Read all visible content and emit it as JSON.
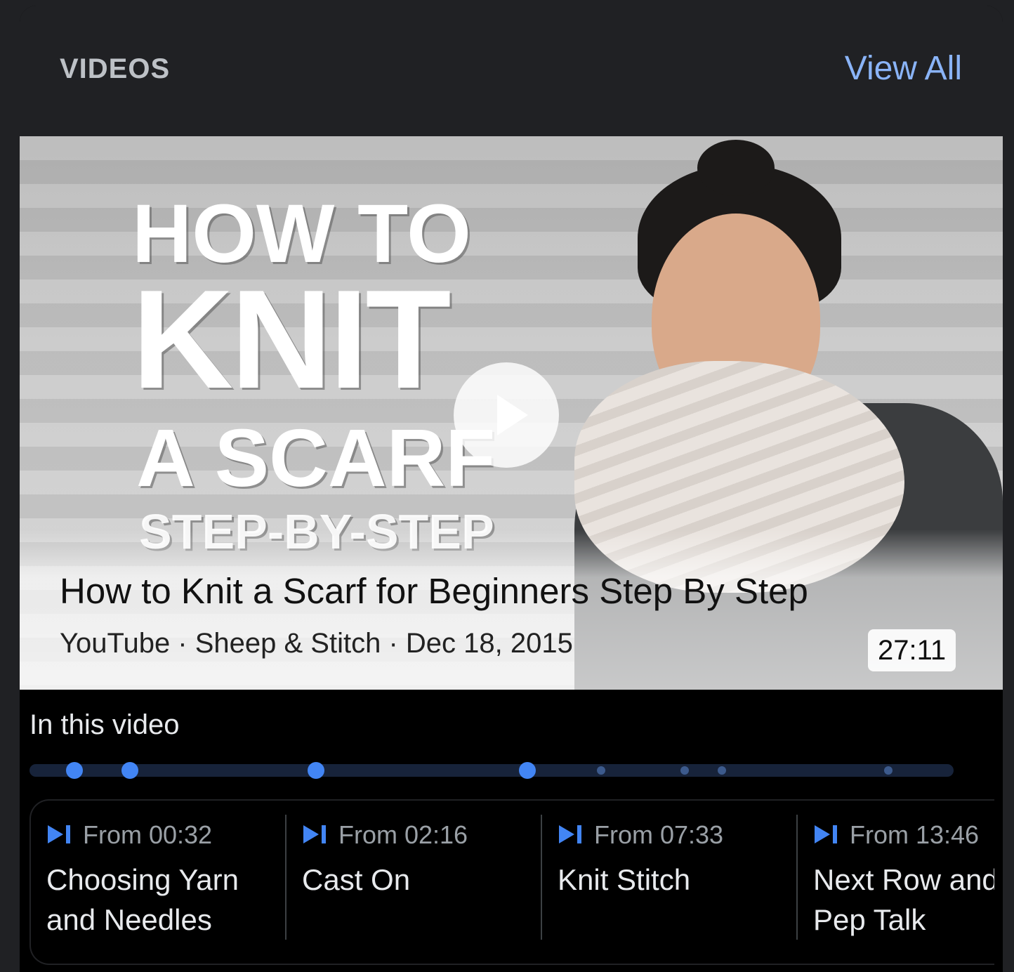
{
  "header": {
    "section_title": "VIDEOS",
    "view_all_label": "View All"
  },
  "video": {
    "thumbnail_text": [
      "HOW TO",
      "KNIT",
      "A SCARF",
      "STEP-BY-STEP"
    ],
    "title": "How to Knit a Scarf for Beginners Step By Step",
    "meta": "YouTube · Sheep & Stitch · Dec 18, 2015",
    "duration": "27:11"
  },
  "chapters_section": {
    "heading": "In this video",
    "timeline_markers": [
      {
        "time": "00:32",
        "major": true
      },
      {
        "time": "02:16",
        "major": true
      },
      {
        "time": "07:33",
        "major": true
      },
      {
        "time": "13:46",
        "major": true
      },
      {
        "major": false
      },
      {
        "major": false
      },
      {
        "major": false
      },
      {
        "major": false
      }
    ],
    "items": [
      {
        "from": "From 00:32",
        "lines": [
          "Choosing Yarn",
          "and Needles"
        ]
      },
      {
        "from": "From 02:16",
        "lines": [
          "Cast On"
        ]
      },
      {
        "from": "From 07:33",
        "lines": [
          "Knit Stitch"
        ]
      },
      {
        "from": "From 13:46",
        "lines": [
          "Next Row and",
          "Pep Talk"
        ]
      }
    ]
  },
  "colors": {
    "accent": "#8ab4f8",
    "marker": "#4285f4",
    "card_background": "#000000",
    "header_background": "#202124"
  }
}
